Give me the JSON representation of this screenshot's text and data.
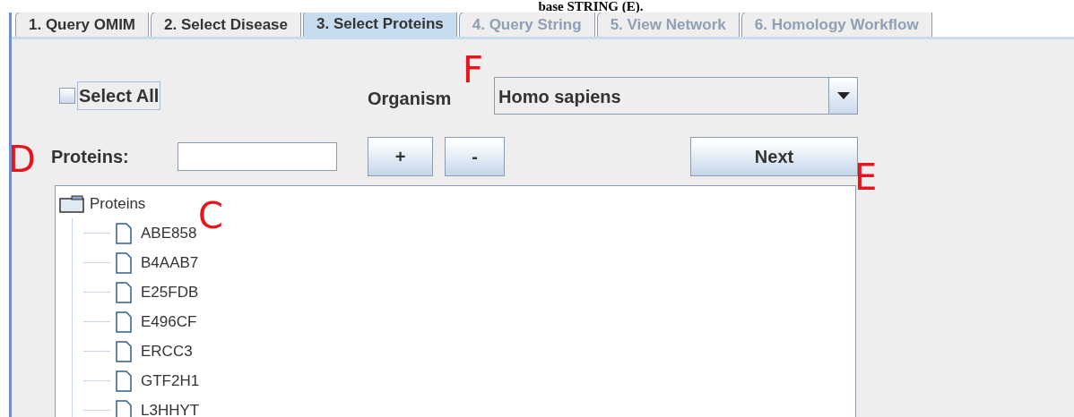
{
  "caption": "base STRING (E).",
  "tabs": [
    {
      "label": "1. Query OMIM",
      "selected": false,
      "disabled": false
    },
    {
      "label": "2. Select Disease",
      "selected": false,
      "disabled": false
    },
    {
      "label": "3. Select Proteins",
      "selected": true,
      "disabled": false
    },
    {
      "label": "4. Query String",
      "selected": false,
      "disabled": true
    },
    {
      "label": "5. View Network",
      "selected": false,
      "disabled": true
    },
    {
      "label": "6. Homology Workflow",
      "selected": false,
      "disabled": true
    }
  ],
  "select_all": {
    "label": "Select All",
    "checked": false
  },
  "organism": {
    "label": "Organism",
    "value": "Homo sapiens"
  },
  "proteins_field": {
    "label": "Proteins:"
  },
  "buttons": {
    "add": "+",
    "remove": "-",
    "next": "Next"
  },
  "tree": {
    "label": "Proteins",
    "children": [
      {
        "label": "ABE858"
      },
      {
        "label": "B4AAB7"
      },
      {
        "label": "E25FDB"
      },
      {
        "label": "E496CF"
      },
      {
        "label": "ERCC3"
      },
      {
        "label": "GTF2H1"
      },
      {
        "label": "L3HHYT"
      }
    ]
  },
  "annotations": [
    "F",
    "D",
    "E",
    "C"
  ]
}
